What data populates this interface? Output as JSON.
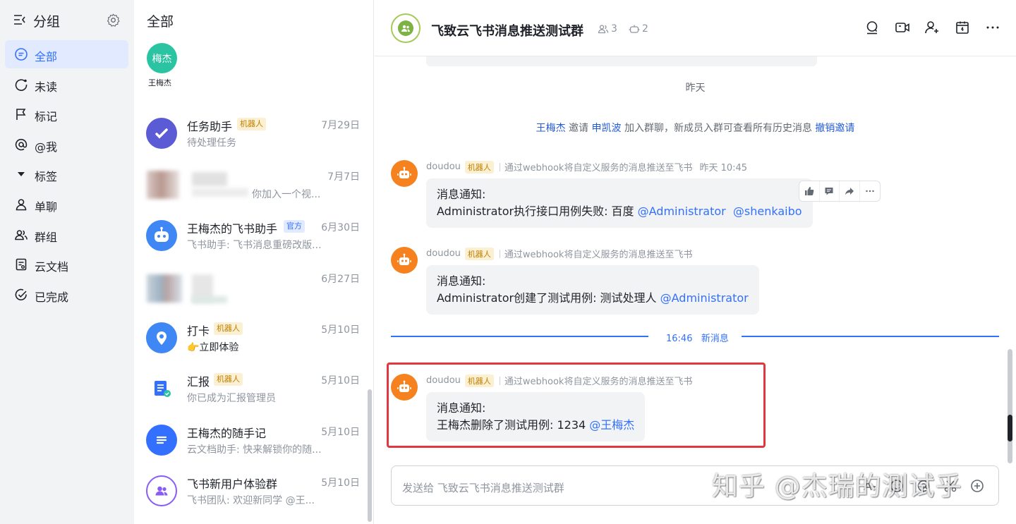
{
  "sidebar": {
    "title": "分组",
    "items": [
      {
        "label": "全部",
        "icon": "chat-icon",
        "active": true
      },
      {
        "label": "未读",
        "icon": "unread-icon"
      },
      {
        "label": "标记",
        "icon": "flag-icon"
      },
      {
        "label": "@我",
        "icon": "at-icon"
      },
      {
        "label": "标签",
        "icon": "triangle-down-icon"
      },
      {
        "label": "单聊",
        "icon": "user-icon"
      },
      {
        "label": "群组",
        "icon": "group-icon"
      },
      {
        "label": "云文档",
        "icon": "doc-icon"
      },
      {
        "label": "已完成",
        "icon": "check-circle-icon"
      }
    ]
  },
  "chat_list": {
    "title": "全部",
    "quick_contact": {
      "avatar_text": "梅杰",
      "name": "王梅杰"
    },
    "chats": [
      {
        "name": "任务助手",
        "tag": "机器人",
        "date": "7月29日",
        "preview": "待处理任务"
      },
      {
        "name": "",
        "tag": "",
        "date": "7月7日",
        "preview": "你加入一个视..."
      },
      {
        "name": "王梅杰的飞书助手",
        "tag": "官方",
        "date": "6月30日",
        "preview": "飞书助手: 飞书消息重磅改版..."
      },
      {
        "name": "",
        "tag": "",
        "date": "6月27日",
        "preview": ""
      },
      {
        "name": "打卡",
        "tag": "机器人",
        "date": "5月10日",
        "preview": "👉立即体验"
      },
      {
        "name": "汇报",
        "tag": "机器人",
        "date": "5月10日",
        "preview": "你已成为汇报管理员"
      },
      {
        "name": "王梅杰的随手记",
        "tag": "",
        "date": "5月10日",
        "preview": "云文档助手: 快来解锁你的随..."
      },
      {
        "name": "飞书新用户体验群",
        "tag": "",
        "date": "5月10日",
        "preview": "飞书团队: 欢迎新同学 @王..."
      }
    ]
  },
  "conversation": {
    "title": "飞致云飞书消息推送测试群",
    "member_count": "3",
    "bot_count": "2",
    "day_separator": "昨天",
    "system_message": {
      "inviter": "王梅杰",
      "verb": "邀请",
      "invitee": "申凯波",
      "text": "加入群聊，新成员入群可查看所有历史消息",
      "revoke": "撤销邀请"
    },
    "messages": [
      {
        "sender": "doudou",
        "tag": "机器人",
        "desc": "通过webhook将自定义服务的消息推送至飞书",
        "time": "昨天 10:45",
        "line1": "消息通知:",
        "line2": "Administrator执行接口用例失败: 百度 ",
        "mention1": "@Administrator",
        "mention2": "@shenkaibo"
      },
      {
        "sender": "doudou",
        "tag": "机器人",
        "desc": "通过webhook将自定义服务的消息推送至飞书",
        "line1": "消息通知:",
        "line2": "Administrator创建了测试用例: 测试处理人 ",
        "mention1": "@Administrator"
      },
      {
        "sender": "doudou",
        "tag": "机器人",
        "desc": "通过webhook将自定义服务的消息推送至飞书",
        "line1": "消息通知:",
        "line2": "王梅杰删除了测试用例: 1234 ",
        "mention1": "@王梅杰"
      }
    ],
    "new_message_divider": {
      "time": "16:46",
      "label": "新消息"
    },
    "input_placeholder": "发送给 飞致云飞书消息推送测试群"
  },
  "watermark": "知乎 @杰瑞的测试乎",
  "colors": {
    "accent": "#3370ff",
    "highlight_border": "#e0383e",
    "bot_avatar": "#f5821f"
  }
}
